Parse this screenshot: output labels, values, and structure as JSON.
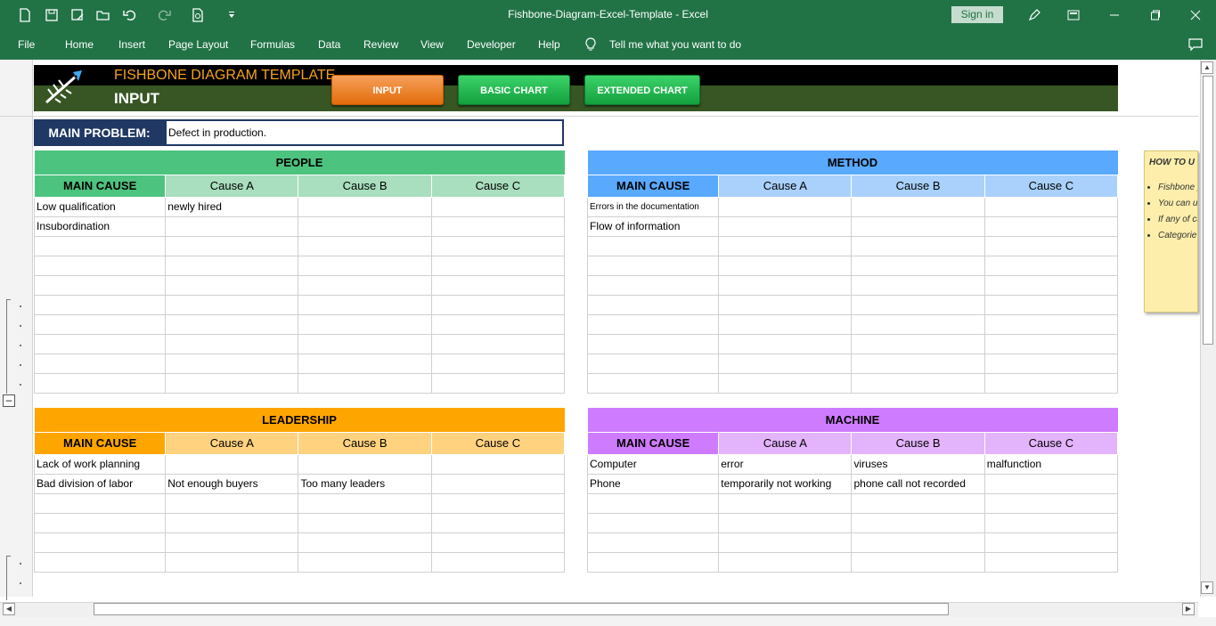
{
  "window": {
    "title": "Fishbone-Diagram-Excel-Template  -  Excel",
    "sign_in": "Sign in"
  },
  "ribbon": {
    "tabs": [
      "File",
      "Home",
      "Insert",
      "Page Layout",
      "Formulas",
      "Data",
      "Review",
      "View",
      "Developer",
      "Help"
    ],
    "tell_me": "Tell me what you want to do"
  },
  "header": {
    "title": "FISHBONE DIAGRAM TEMPLATE",
    "subtitle": "INPUT",
    "buttons": {
      "input": "INPUT",
      "basic_chart": "BASIC CHART",
      "extended_chart": "EXTENDED CHART"
    }
  },
  "main_problem": {
    "label": "MAIN PROBLEM:",
    "value": "Defect in production."
  },
  "columns": {
    "main": "MAIN CAUSE",
    "a": "Cause A",
    "b": "Cause B",
    "c": "Cause C"
  },
  "categories": {
    "people": {
      "title": "PEOPLE",
      "rows": [
        [
          "Low qualification",
          "newly hired",
          "",
          ""
        ],
        [
          "Insubordination",
          "",
          "",
          ""
        ]
      ]
    },
    "method": {
      "title": "METHOD",
      "rows": [
        [
          "Errors in the documentation",
          "",
          "",
          ""
        ],
        [
          "Flow of information",
          "",
          "",
          ""
        ]
      ]
    },
    "leadership": {
      "title": "LEADERSHIP",
      "rows": [
        [
          "Lack of work planning",
          "",
          "",
          ""
        ],
        [
          "Bad division of labor",
          "Not enough buyers",
          "Too many leaders",
          ""
        ]
      ]
    },
    "machine": {
      "title": "MACHINE",
      "rows": [
        [
          "Computer",
          "error",
          "viruses",
          "malfunction"
        ],
        [
          "Phone",
          "temporarily not working",
          "phone call not recorded",
          ""
        ]
      ]
    }
  },
  "note": {
    "heading": "HOW TO U",
    "items": [
      "Fishbone pillars, th",
      "You can u causes re",
      "If any of cause you B or caus",
      "Categorie avoid wri"
    ]
  },
  "colors": {
    "excel_green": "#217346",
    "people": "#4cc37f",
    "method": "#59a9ff",
    "leadership": "#ffa500",
    "machine": "#cf7bff",
    "main_problem": "#1f3864"
  }
}
